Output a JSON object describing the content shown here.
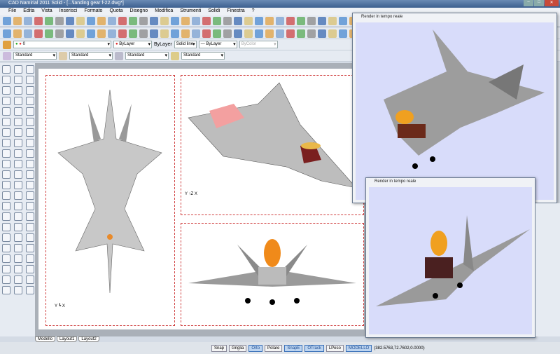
{
  "window": {
    "title": "CAD Namirial 2011 Solid - [...\\landing gear f-22.dwg*]"
  },
  "menu": [
    "File",
    "Edita",
    "Vista",
    "Inserisci",
    "Formato",
    "Quota",
    "Disegno",
    "Modifica",
    "Strumenti",
    "Solidi",
    "Finestra",
    "?"
  ],
  "layer_bar": {
    "layer": "0",
    "color": "ByLayer",
    "linetype": "ByLayer",
    "lineweight_label": "Solid line",
    "lineweight": "ByLayer",
    "plotstyle": "ByColor"
  },
  "style_bar": {
    "text_style": "Standard",
    "dim_style": "Standard",
    "table_style": "Standard",
    "mleader_style": "Standard"
  },
  "render_windows": [
    {
      "title": "Render in tempo reale"
    },
    {
      "title": "Render in tempo reale"
    }
  ],
  "tabs": [
    "Modello",
    "Layout1",
    "Layout2"
  ],
  "status": {
    "buttons": [
      {
        "label": "Snap",
        "on": false
      },
      {
        "label": "Griglia",
        "on": false
      },
      {
        "label": "Orto",
        "on": true
      },
      {
        "label": "Polare",
        "on": false
      },
      {
        "label": "SnapE",
        "on": true
      },
      {
        "label": "OTrack",
        "on": true
      },
      {
        "label": "LPeso",
        "on": false
      },
      {
        "label": "MODELLO",
        "on": true
      }
    ],
    "coords": "(382.5763,72.7602,0.0000)"
  },
  "colors": {
    "render_bg": "#d8dcfa",
    "viewport_border": "#d04040",
    "titlebar": "#3c5f8f"
  }
}
